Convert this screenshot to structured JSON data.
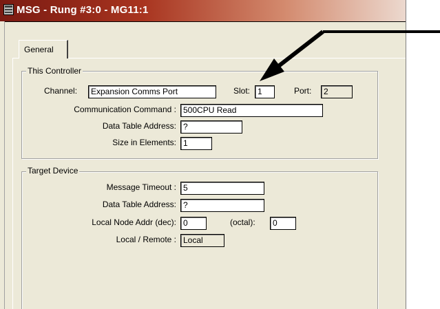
{
  "window": {
    "title": "MSG - Rung #3:0 - MG11:1",
    "icon": "msg-instruction-icon"
  },
  "tabs": [
    {
      "label": "General"
    }
  ],
  "this_controller": {
    "legend": "This Controller",
    "channel_label": "Channel:",
    "channel_value": "Expansion Comms Port",
    "slot_label": "Slot:",
    "slot_value": "1",
    "port_label": "Port:",
    "port_value": "2",
    "command_label": "Communication Command :",
    "command_value": "500CPU Read",
    "dta_label": "Data Table Address:",
    "dta_value": "?",
    "size_label": "Size in Elements:",
    "size_value": "1"
  },
  "target_device": {
    "legend": "Target Device",
    "timeout_label": "Message Timeout :",
    "timeout_value": "5",
    "dta_label": "Data Table Address:",
    "dta_value": "?",
    "node_dec_label": "Local Node Addr (dec):",
    "node_dec_value": "0",
    "node_oct_label": "(octal):",
    "node_oct_value": "0",
    "local_remote_label": "Local / Remote :",
    "local_remote_value": "Local"
  },
  "annotation": {
    "icon": "pointer-arrow",
    "color": "#000000"
  }
}
